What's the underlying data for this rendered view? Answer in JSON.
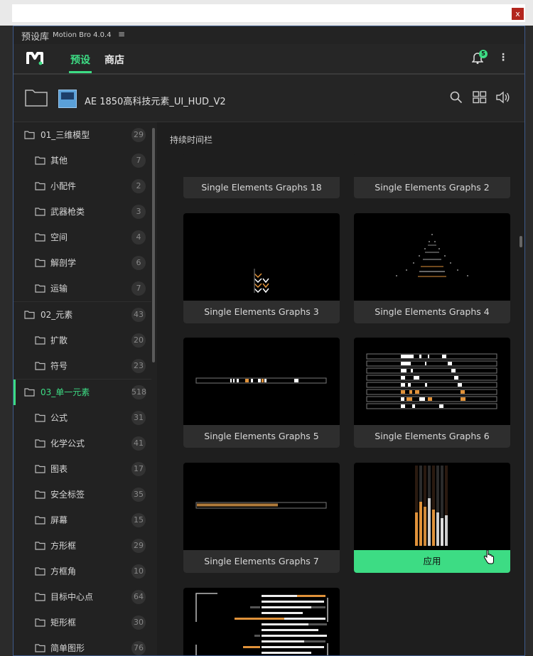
{
  "window": {
    "close_label": "x",
    "title_cn": "预设库",
    "title_en": "Motion Bro 4.0.4",
    "menu_glyph": "≡"
  },
  "nav": {
    "tabs": [
      {
        "label": "预设",
        "active": true
      },
      {
        "label": "商店",
        "active": false
      }
    ],
    "notification_count": "5",
    "more_glyph": "⋮"
  },
  "path": {
    "pack_name": "AE 1850高科技元素_UI_HUD_V2"
  },
  "sidebar": {
    "items": [
      {
        "label": "01_三维模型",
        "count": "29",
        "level": 0
      },
      {
        "label": "其他",
        "count": "7",
        "level": 1
      },
      {
        "label": "小配件",
        "count": "2",
        "level": 1
      },
      {
        "label": "武器枪类",
        "count": "3",
        "level": 1
      },
      {
        "label": "空间",
        "count": "4",
        "level": 1
      },
      {
        "label": "解剖学",
        "count": "6",
        "level": 1
      },
      {
        "label": "运输",
        "count": "7",
        "level": 1
      },
      {
        "label": "02_元素",
        "count": "43",
        "level": 0
      },
      {
        "label": "扩散",
        "count": "20",
        "level": 1
      },
      {
        "label": "符号",
        "count": "23",
        "level": 1
      },
      {
        "label": "03_单一元素",
        "count": "518",
        "level": 0,
        "active": true
      },
      {
        "label": "公式",
        "count": "31",
        "level": 1
      },
      {
        "label": "化学公式",
        "count": "41",
        "level": 1
      },
      {
        "label": "图表",
        "count": "17",
        "level": 1
      },
      {
        "label": "安全标签",
        "count": "35",
        "level": 1
      },
      {
        "label": "屏幕",
        "count": "15",
        "level": 1
      },
      {
        "label": "方形框",
        "count": "29",
        "level": 1
      },
      {
        "label": "方框角",
        "count": "10",
        "level": 1
      },
      {
        "label": "目标中心点",
        "count": "64",
        "level": 1
      },
      {
        "label": "矩形框",
        "count": "30",
        "level": 1
      },
      {
        "label": "简单图形",
        "count": "76",
        "level": 1
      }
    ]
  },
  "content": {
    "section_title": "持续时间栏",
    "cards": [
      {
        "label": "Single Elements Graphs 18"
      },
      {
        "label": "Single Elements Graphs 2"
      },
      {
        "label": "Single Elements Graphs 3"
      },
      {
        "label": "Single Elements Graphs 4"
      },
      {
        "label": "Single Elements Graphs 5"
      },
      {
        "label": "Single Elements Graphs 6"
      },
      {
        "label": "Single Elements Graphs 7"
      },
      {
        "label": "应用"
      },
      {
        "label": ""
      }
    ]
  },
  "colors": {
    "accent": "#3ddc84",
    "orange": "#e0923a",
    "panel_border": "#3e5a8a"
  }
}
